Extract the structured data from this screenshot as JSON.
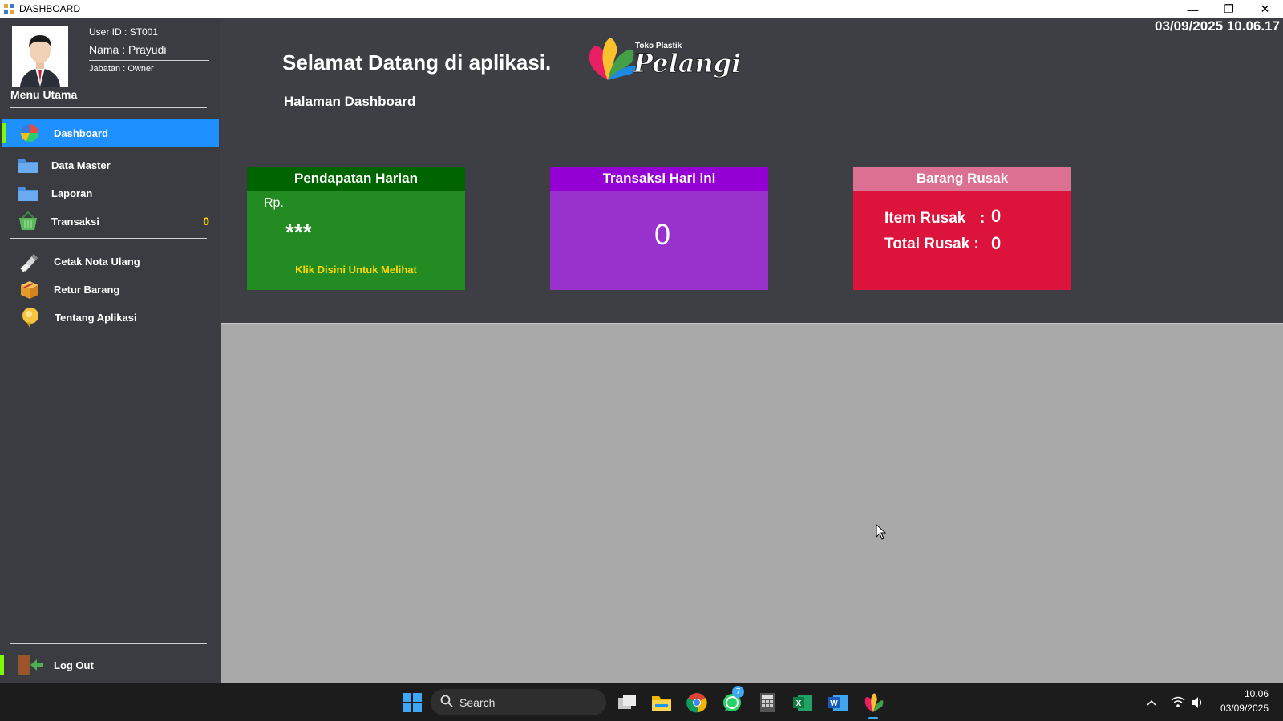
{
  "window": {
    "title": "DASHBOARD",
    "minimize": "—",
    "restore": "❐",
    "close": "✕"
  },
  "user": {
    "id": "User ID : ST001",
    "name": "Nama : Prayudi",
    "job": "Jabatan : Owner"
  },
  "sidebar": {
    "menu_title": "Menu Utama",
    "items": [
      {
        "label": "Dashboard",
        "icon": "pie-chart-icon"
      },
      {
        "label": "Data Master",
        "icon": "folder-icon"
      },
      {
        "label": "Laporan",
        "icon": "folder-icon"
      },
      {
        "label": "Transaksi",
        "icon": "basket-icon",
        "count": "0"
      },
      {
        "label": "Cetak Nota Ulang",
        "icon": "print-icon"
      },
      {
        "label": "Retur Barang",
        "icon": "box-icon"
      },
      {
        "label": "Tentang Aplikasi",
        "icon": "bulb-icon"
      }
    ],
    "logout": "Log Out"
  },
  "header": {
    "datetime": "03/09/2025  10.06.17",
    "welcome": "Selamat Datang di aplikasi.",
    "subtitle": "Halaman Dashboard",
    "logo_small": "Toko Plastik",
    "logo_big": "Pelangi"
  },
  "cards": {
    "income": {
      "title": "Pendapatan Harian",
      "currency": "Rp.",
      "value": "***",
      "link": "Klik Disini Untuk Melihat"
    },
    "transactions": {
      "title": "Transaksi Hari ini",
      "value": "0"
    },
    "damaged": {
      "title": "Barang Rusak",
      "item_label": "Item Rusak",
      "item_sep": ":",
      "item_value": "0",
      "total_label": "Total Rusak :",
      "total_value": "0"
    }
  },
  "taskbar": {
    "search_placeholder": "Search",
    "whatsapp_badge": "7",
    "time": "10.06",
    "date": "03/09/2025"
  },
  "colors": {
    "sidebar_bg": "#3a3c41",
    "active_menu": "#1e90ff",
    "accent_bar": "#7cfc00",
    "income_header": "#006400",
    "income_body": "#228b22",
    "trans_header": "#9400d3",
    "trans_body": "#9932cc",
    "damaged_header": "#db7093",
    "damaged_body": "#dc143c",
    "gray_area": "#a9a9a9",
    "count_color": "#ffd700"
  }
}
